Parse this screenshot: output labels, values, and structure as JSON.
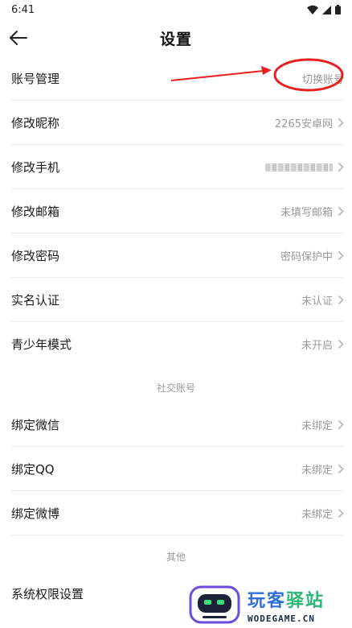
{
  "status_bar": {
    "time": "6:41"
  },
  "header": {
    "title": "设置"
  },
  "rows_main": [
    {
      "label": "账号管理",
      "value": "切换账号",
      "name": "row-account-management"
    },
    {
      "label": "修改昵称",
      "value": "2265安卓网",
      "name": "row-change-nickname"
    },
    {
      "label": "修改手机",
      "value": "",
      "name": "row-change-phone"
    },
    {
      "label": "修改邮箱",
      "value": "未填写邮箱",
      "name": "row-change-email"
    },
    {
      "label": "修改密码",
      "value": "密码保护中",
      "name": "row-change-password"
    },
    {
      "label": "实名认证",
      "value": "未认证",
      "name": "row-real-name-verification"
    },
    {
      "label": "青少年模式",
      "value": "未开启",
      "name": "row-teen-mode"
    }
  ],
  "section_social": {
    "title": "社交账号"
  },
  "rows_social": [
    {
      "label": "绑定微信",
      "value": "未绑定",
      "name": "row-bind-wechat"
    },
    {
      "label": "绑定QQ",
      "value": "未绑定",
      "name": "row-bind-qq"
    },
    {
      "label": "绑定微博",
      "value": "未绑定",
      "name": "row-bind-weibo"
    }
  ],
  "section_other": {
    "title": "其他"
  },
  "rows_other": [
    {
      "label": "系统权限设置",
      "value": "",
      "name": "row-system-permissions"
    }
  ],
  "watermark": {
    "cn_part1": "玩客",
    "cn_part2": "驿站",
    "en": "WODEGAME.CN"
  },
  "colors": {
    "annotation_red": "#e8201f",
    "chevron": "#b5b5b5"
  }
}
